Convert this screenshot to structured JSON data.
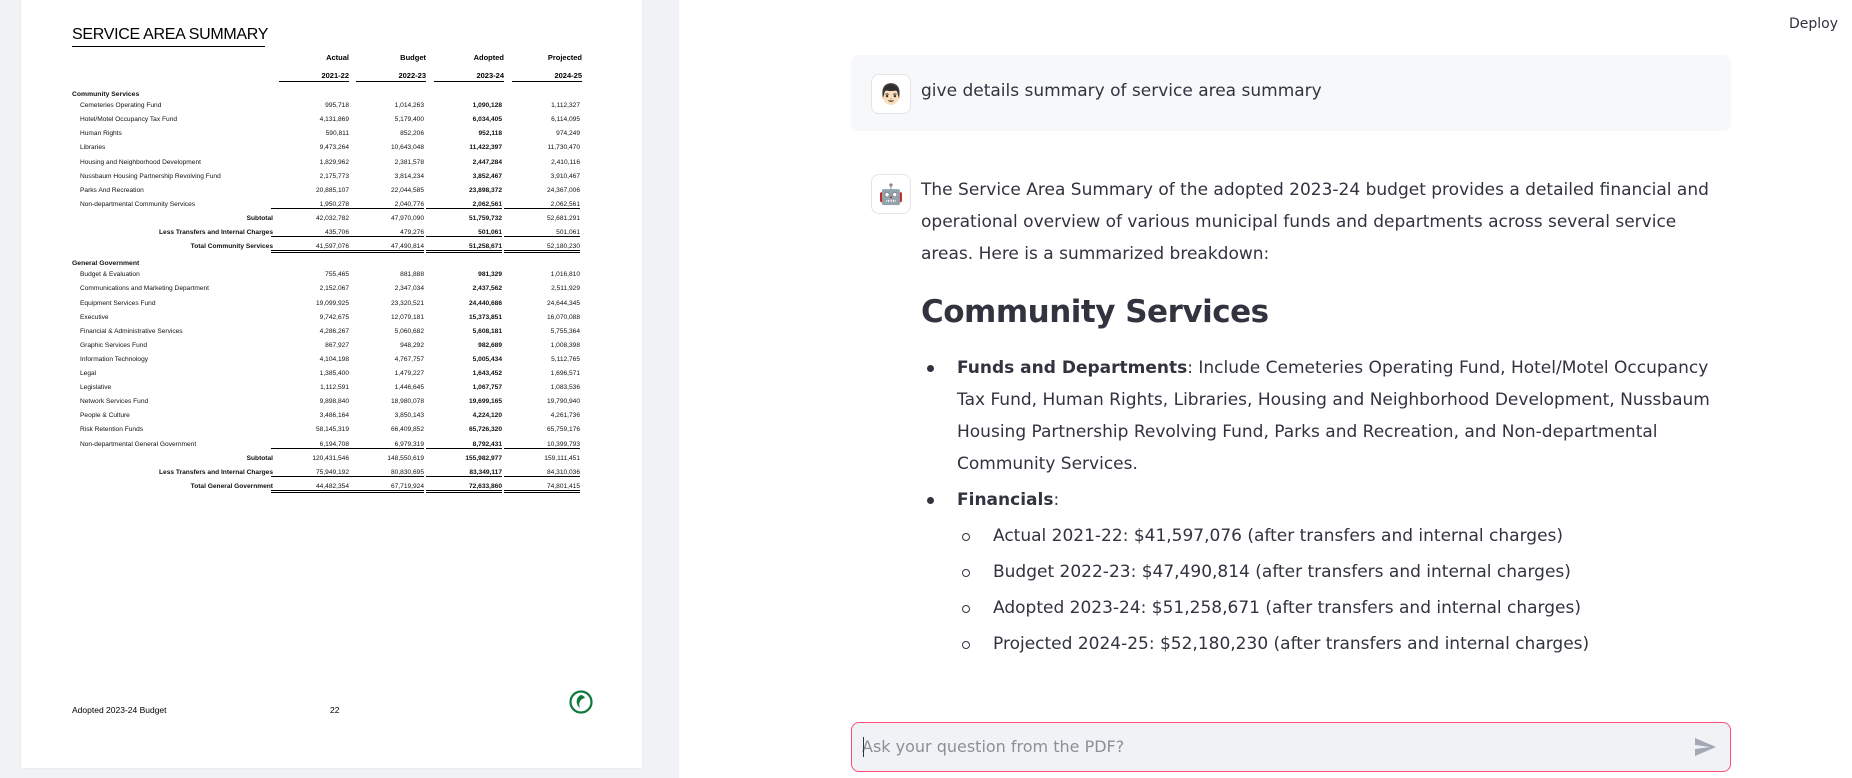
{
  "pdf": {
    "title": "SERVICE AREA SUMMARY",
    "columns": [
      {
        "name": "Actual",
        "year": "2021-22"
      },
      {
        "name": "Budget",
        "year": "2022-23"
      },
      {
        "name": "Adopted",
        "year": "2023-24"
      },
      {
        "name": "Projected",
        "year": "2024-25"
      }
    ],
    "community": {
      "heading": "Community Services",
      "rows": [
        {
          "label": "Cemeteries Operating Fund",
          "values": [
            "995,718",
            "1,014,263",
            "1,090,128",
            "1,112,327"
          ]
        },
        {
          "label": "Hotel/Motel Occupancy Tax Fund",
          "values": [
            "4,131,869",
            "5,179,400",
            "6,034,405",
            "6,114,095"
          ]
        },
        {
          "label": "Human Rights",
          "values": [
            "590,811",
            "852,206",
            "952,118",
            "974,249"
          ]
        },
        {
          "label": "Libraries",
          "values": [
            "9,473,264",
            "10,643,048",
            "11,422,397",
            "11,730,470"
          ]
        },
        {
          "label": "Housing and Neighborhood Development",
          "values": [
            "1,829,962",
            "2,381,578",
            "2,447,284",
            "2,410,116"
          ]
        },
        {
          "label": "Nussbaum Housing Partnership Revolving Fund",
          "values": [
            "2,175,773",
            "3,814,234",
            "3,852,467",
            "3,910,467"
          ]
        },
        {
          "label": "Parks And Recreation",
          "values": [
            "20,885,107",
            "22,044,585",
            "23,898,372",
            "24,367,006"
          ]
        },
        {
          "label": "Non-departmental Community Services",
          "values": [
            "1,950,278",
            "2,040,776",
            "2,062,561",
            "2,062,561"
          ]
        }
      ],
      "subtotal": {
        "label": "Subtotal",
        "values": [
          "42,032,782",
          "47,970,090",
          "51,759,732",
          "52,681,291"
        ]
      },
      "transfers": {
        "label": "Less Transfers and Internal Charges",
        "values": [
          "435,706",
          "479,276",
          "501,061",
          "501,061"
        ]
      },
      "total": {
        "label": "Total Community Services",
        "values": [
          "41,597,076",
          "47,490,814",
          "51,258,671",
          "52,180,230"
        ]
      }
    },
    "general": {
      "heading": "General Government",
      "rows": [
        {
          "label": "Budget & Evaluation",
          "values": [
            "755,465",
            "881,888",
            "981,329",
            "1,016,810"
          ]
        },
        {
          "label": "Communications and Marketing Department",
          "values": [
            "2,152,067",
            "2,347,034",
            "2,437,562",
            "2,511,929"
          ]
        },
        {
          "label": "Equipment Services Fund",
          "values": [
            "19,099,925",
            "23,320,521",
            "24,440,686",
            "24,644,345"
          ]
        },
        {
          "label": "Executive",
          "values": [
            "9,742,675",
            "12,079,181",
            "15,373,851",
            "16,070,088"
          ]
        },
        {
          "label": "Financial & Administrative Services",
          "values": [
            "4,286,267",
            "5,060,682",
            "5,608,181",
            "5,755,364"
          ]
        },
        {
          "label": "Graphic Services Fund",
          "values": [
            "867,927",
            "948,292",
            "982,689",
            "1,008,398"
          ]
        },
        {
          "label": "Information Technology",
          "values": [
            "4,104,198",
            "4,767,757",
            "5,005,434",
            "5,112,765"
          ]
        },
        {
          "label": "Legal",
          "values": [
            "1,385,400",
            "1,479,227",
            "1,643,452",
            "1,696,571"
          ]
        },
        {
          "label": "Legislative",
          "values": [
            "1,112,591",
            "1,446,645",
            "1,067,757",
            "1,083,536"
          ]
        },
        {
          "label": "Network Services Fund",
          "values": [
            "9,898,840",
            "18,980,078",
            "19,699,165",
            "19,790,940"
          ]
        },
        {
          "label": "People & Culture",
          "values": [
            "3,486,164",
            "3,850,143",
            "4,224,120",
            "4,261,736"
          ]
        },
        {
          "label": "Risk Retention Funds",
          "values": [
            "58,145,319",
            "66,409,852",
            "65,726,320",
            "65,759,176"
          ]
        },
        {
          "label": "Non-departmental General Government",
          "values": [
            "6,194,708",
            "6,979,319",
            "8,792,431",
            "10,399,793"
          ]
        }
      ],
      "subtotal": {
        "label": "Subtotal",
        "values": [
          "120,431,546",
          "148,550,619",
          "155,982,977",
          "159,111,451"
        ]
      },
      "transfers": {
        "label": "Less Transfers and Internal Charges",
        "values": [
          "75,949,192",
          "80,830,695",
          "83,349,117",
          "84,310,036"
        ]
      },
      "total": {
        "label": "Total General Government",
        "values": [
          "44,482,354",
          "67,719,924",
          "72,633,860",
          "74,801,415"
        ]
      }
    },
    "footer": {
      "left": "Adopted 2023-24 Budget",
      "page": "22"
    }
  },
  "header": {
    "deploy_label": "Deploy"
  },
  "chat": {
    "user_avatar": "👨🏻",
    "bot_avatar": "🤖",
    "user_message": "give details summary of service area summary",
    "bot_intro": "The Service Area Summary of the adopted 2023-24 budget provides a detailed financial and operational overview of various municipal funds and departments across several service areas. Here is a summarized breakdown:",
    "section_heading": "Community Services",
    "funds_label": "Funds and Departments",
    "funds_text": ": Include Cemeteries Operating Fund, Hotel/Motel Occupancy Tax Fund, Human Rights, Libraries, Housing and Neighborhood Development, Nussbaum Housing Partnership Revolving Fund, Parks and Recreation, and Non-departmental Community Services.",
    "financials_label": "Financials",
    "financials_colon": ":",
    "financials": [
      "Actual 2021-22: $41,597,076 (after transfers and internal charges)",
      "Budget 2022-23: $47,490,814 (after transfers and internal charges)",
      "Adopted 2023-24: $51,258,671 (after transfers and internal charges)",
      "Projected 2024-25: $52,180,230 (after transfers and internal charges)"
    ],
    "input_placeholder": "Ask your question from the PDF?",
    "accent_color": "#ff4b7b"
  }
}
